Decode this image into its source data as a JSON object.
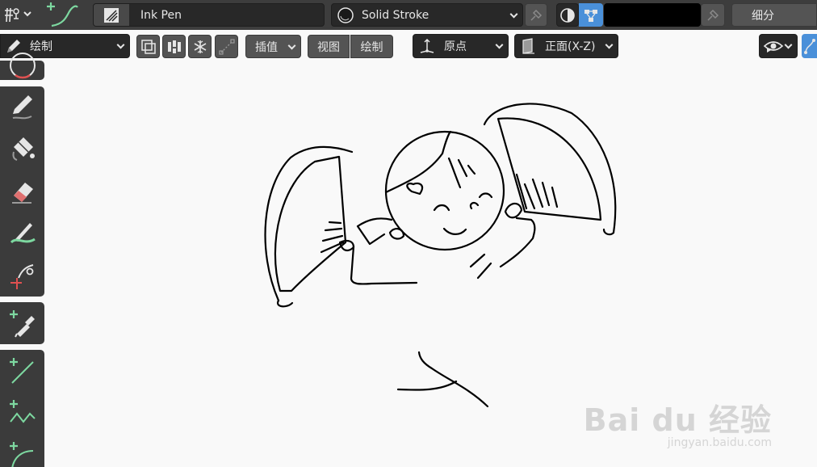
{
  "header": {
    "brush_name": "Ink Pen",
    "material_name": "Solid Stroke",
    "color_value": "#000000",
    "subdivide_label": "细分"
  },
  "modebar": {
    "mode_label": "绘制",
    "interpolate_label": "插值",
    "view_label": "视图",
    "draw_label": "绘制",
    "origin_label": "原点",
    "plane_label": "正面(X-Z)"
  },
  "toolbar": {
    "tools": [
      "circle-tool-icon",
      "pencil-draw-icon",
      "fill-bucket-icon",
      "eraser-icon",
      "tint-brush-icon",
      "cutter-icon",
      "eyedropper-icon",
      "line-icon",
      "polyline-icon",
      "arc-icon"
    ]
  },
  "watermark": {
    "main": "Bai du 经验",
    "sub": "jingyan.baidu.com"
  },
  "colors": {
    "header_bg": "#3d3d3d",
    "widget_dark": "#282828",
    "widget_mid": "#545454",
    "toolbar_bg": "#3b3b3b",
    "viewport_bg": "#f9f9f9",
    "accent_green": "#7dd8a0",
    "accent_blue": "#4a90d9"
  }
}
